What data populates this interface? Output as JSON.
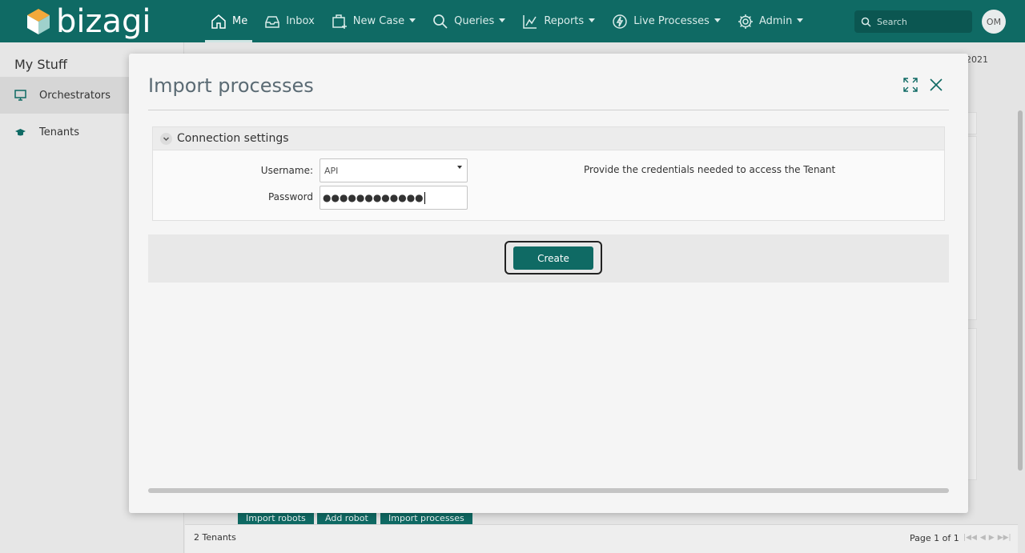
{
  "app": {
    "logo_text": "bizagi",
    "accent_color": "#0f6a64"
  },
  "nav": {
    "items": [
      {
        "label": "Me",
        "icon": "home-icon",
        "active": true
      },
      {
        "label": "Inbox",
        "icon": "inbox-icon"
      },
      {
        "label": "New Case",
        "icon": "new-case-icon"
      },
      {
        "label": "Queries",
        "icon": "search-icon"
      },
      {
        "label": "Reports",
        "icon": "chart-icon"
      },
      {
        "label": "Live Processes",
        "icon": "lightning-icon"
      },
      {
        "label": "Admin",
        "icon": "gear-icon"
      }
    ],
    "search_placeholder": "Search",
    "avatar_initials": "OM"
  },
  "sidebar": {
    "title": "My Stuff",
    "items": [
      {
        "label": "Orchestrators",
        "icon": "monitor-icon",
        "selected": true
      },
      {
        "label": "Tenants",
        "icon": "graduation-cap-icon"
      }
    ]
  },
  "background": {
    "date_fragment": "2021",
    "buttons": [
      "Import robots",
      "Add robot",
      "Import processes"
    ],
    "tenants_count": "2 Tenants",
    "page_label": "Page 1 of 1"
  },
  "modal": {
    "title": "Import processes",
    "section_title": "Connection settings",
    "username_label": "Username:",
    "username_value": "API",
    "password_label": "Password",
    "password_mask": "●●●●●●●●●●●●",
    "help_text": "Provide the credentials needed to access the Tenant",
    "create_label": "Create"
  }
}
